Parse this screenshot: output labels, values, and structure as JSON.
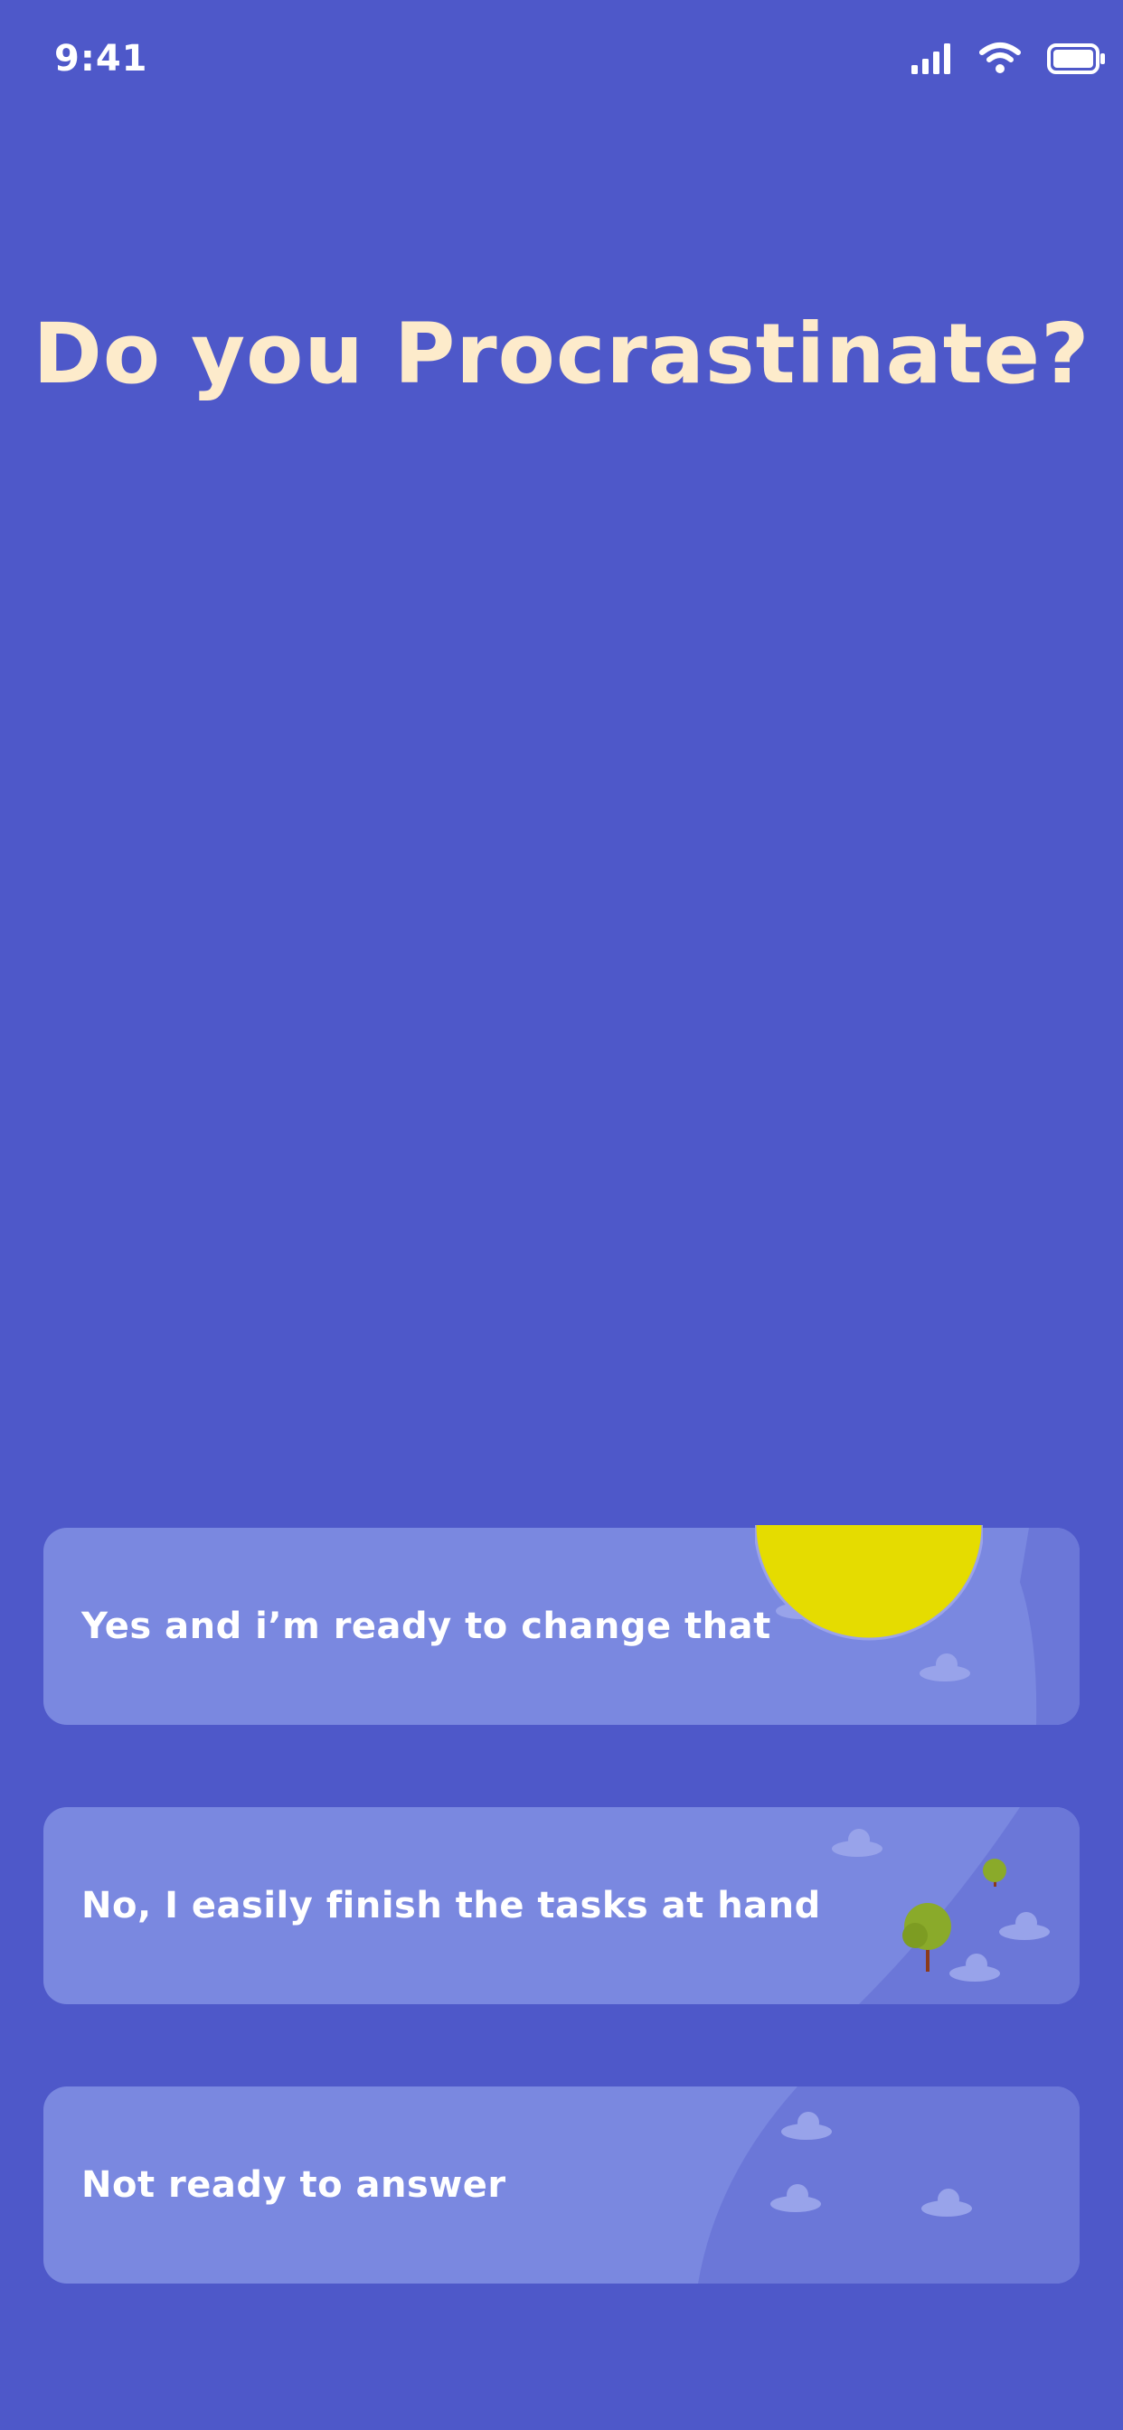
{
  "status_bar": {
    "time": "9:41",
    "icons": [
      "cellular-signal-icon",
      "wifi-icon",
      "battery-icon"
    ]
  },
  "question": {
    "title": "Do you Procrastinate?"
  },
  "options": [
    {
      "label": "Yes and i’m ready to change that"
    },
    {
      "label": "No, I easily finish the tasks at hand"
    },
    {
      "label": "Not ready to answer"
    }
  ],
  "colors": {
    "background": "#4e58c9",
    "card": "#7a88e0",
    "card_shade": "#6b77d8",
    "title": "#fdebcb",
    "sun": "#e5dc00",
    "tree": "#8aaa2a",
    "cloud": "#98a3ea"
  }
}
